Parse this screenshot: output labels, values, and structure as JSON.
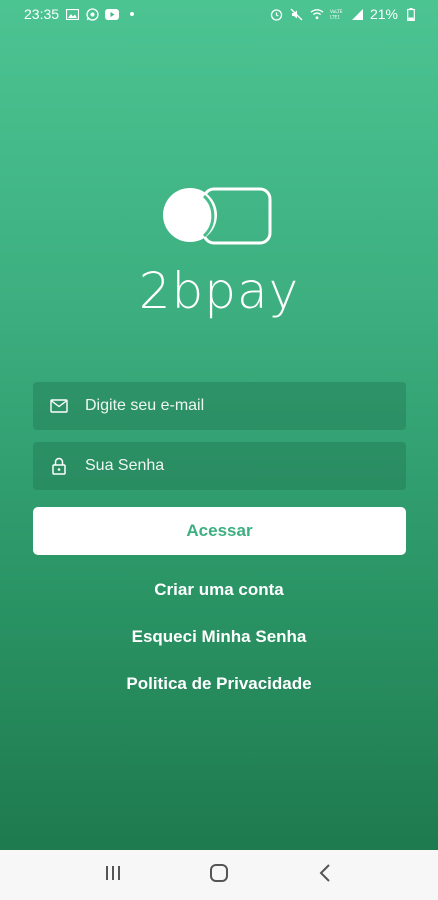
{
  "status_bar": {
    "time": "23:35",
    "battery_percent": "21%",
    "left_icons": [
      "image-icon",
      "whatsapp-icon",
      "youtube-icon",
      "dot-icon"
    ],
    "right_icons": [
      "alarm-icon",
      "mute-icon",
      "wifi-icon",
      "lte-icon",
      "signal-icon",
      "battery-icon"
    ]
  },
  "brand": {
    "name": "2bpay",
    "logo_icon": "2bpay-logo-icon"
  },
  "login": {
    "email_placeholder": "Digite seu e-mail",
    "email_value": "",
    "password_placeholder": "Sua Senha",
    "password_value": "",
    "submit_label": "Acessar"
  },
  "links": {
    "create_account": "Criar uma conta",
    "forgot_password": "Esqueci Minha Senha",
    "privacy_policy": "Politica de Privacidade"
  },
  "nav": {
    "buttons": [
      "recent-apps-icon",
      "home-icon",
      "back-icon"
    ]
  },
  "colors": {
    "accent": "#3daf80",
    "gradient_top": "#4cc492",
    "gradient_bottom": "#1e7a4f"
  }
}
